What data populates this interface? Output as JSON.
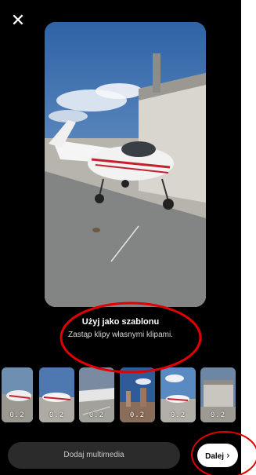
{
  "header": {
    "close_icon": "close-icon"
  },
  "template": {
    "title": "Użyj jako szablonu",
    "subtitle": "Zastąp klipy własnymi klipami."
  },
  "clips": [
    {
      "duration": "0.2"
    },
    {
      "duration": "0.2"
    },
    {
      "duration": "0.2"
    },
    {
      "duration": "0.2"
    },
    {
      "duration": "0.2"
    },
    {
      "duration": "0.2"
    }
  ],
  "footer": {
    "add_media_label": "Dodaj multimedia",
    "next_label": "Dalej",
    "next_icon": "chevron-right-icon"
  },
  "colors": {
    "background": "#000000",
    "annotation": "#e10000",
    "button_dark": "#2b2b2b",
    "button_light": "#ffffff"
  }
}
